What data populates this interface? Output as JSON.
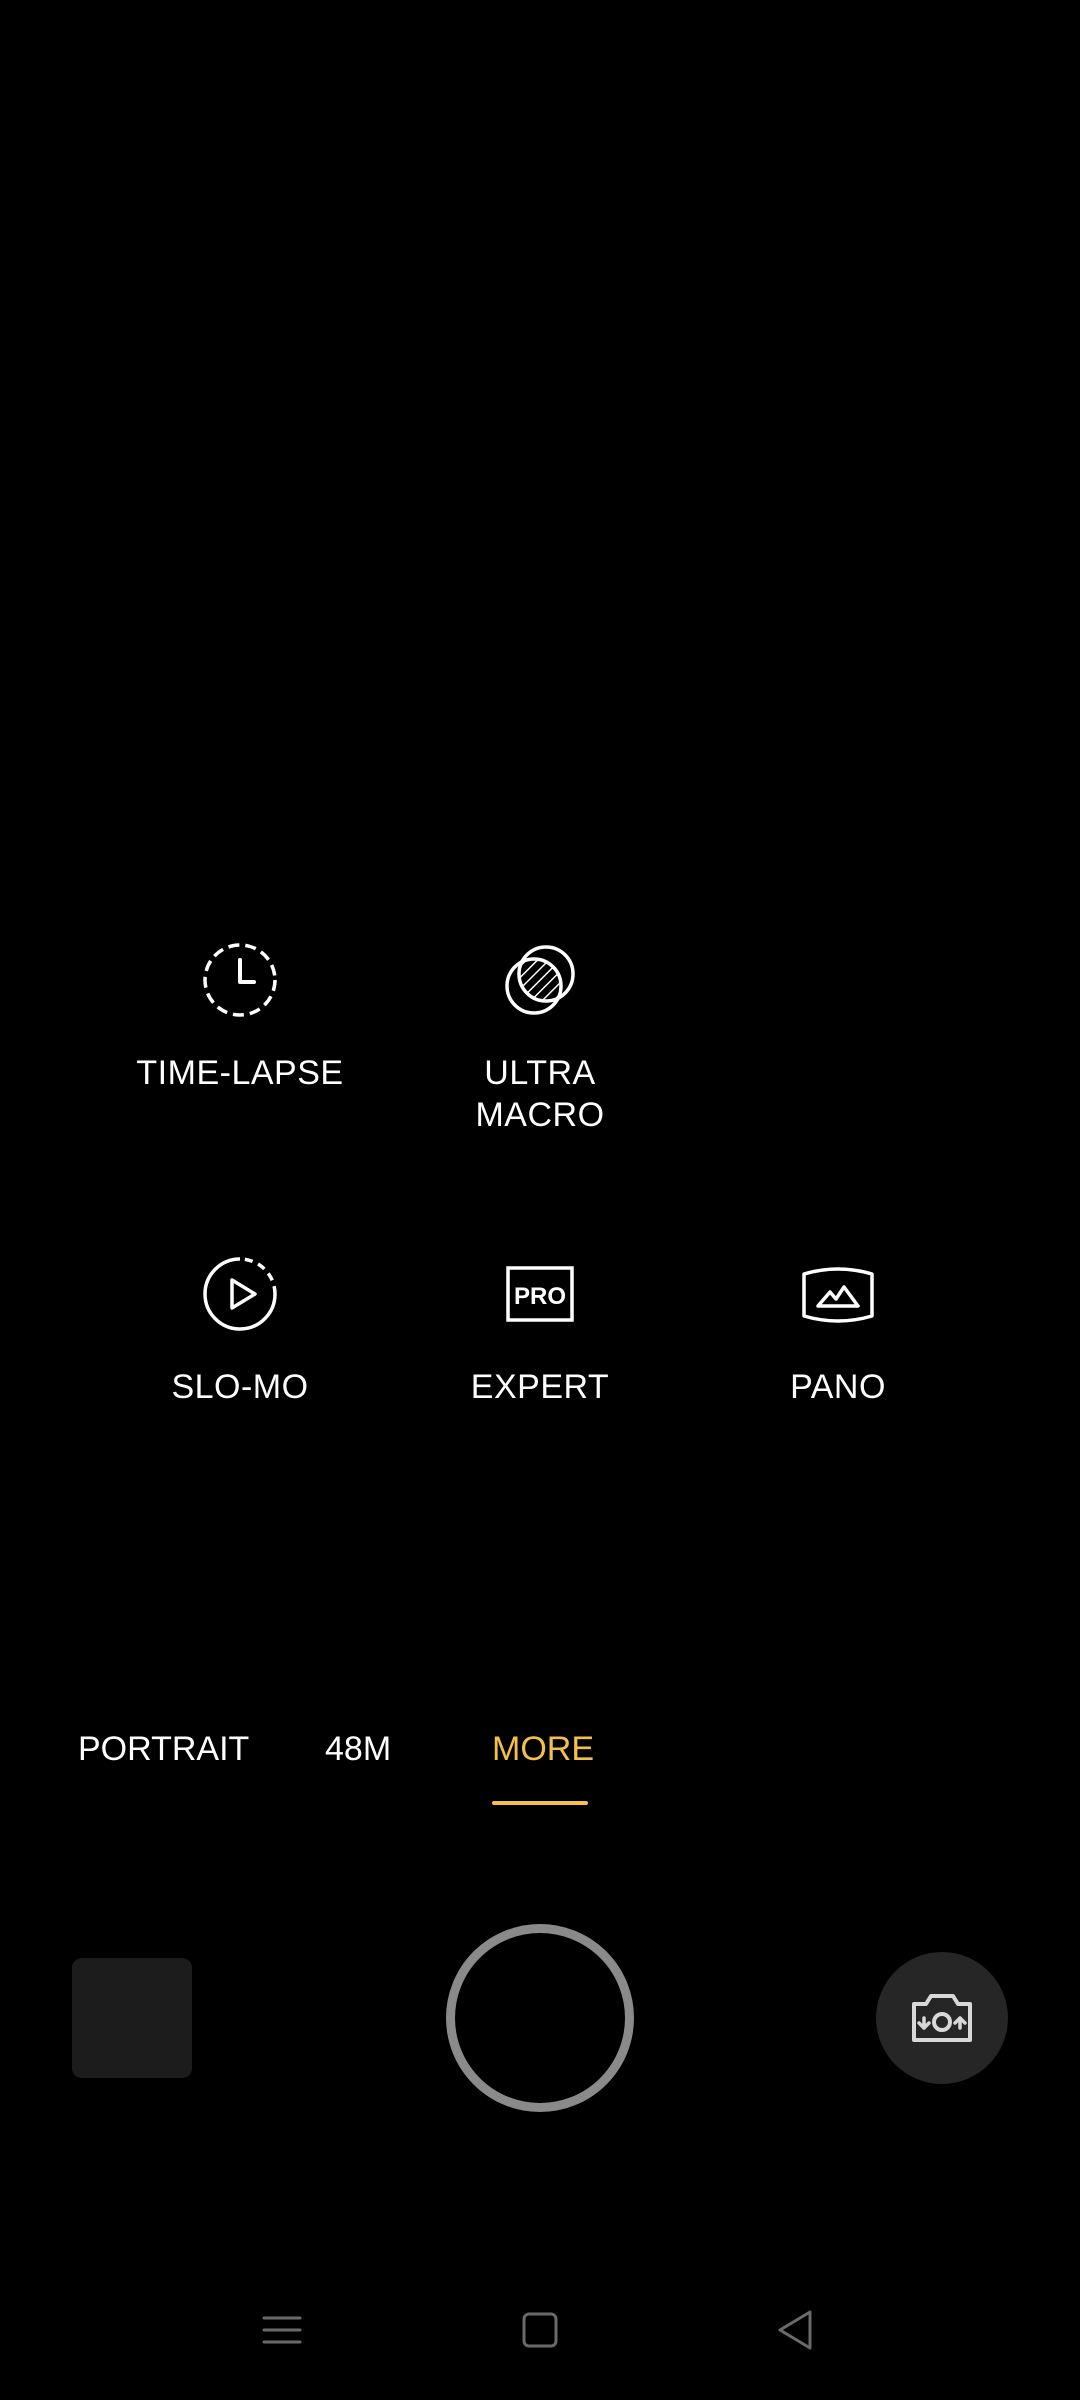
{
  "modes": [
    {
      "label_lines": [
        "TIME-LAPSE"
      ],
      "icon": "time-lapse-icon"
    },
    {
      "label_lines": [
        "ULTRA",
        "MACRO"
      ],
      "icon": "ultra-macro-icon"
    },
    {
      "label_lines": [
        "SLO-MO"
      ],
      "icon": "slo-mo-icon"
    },
    {
      "label_lines": [
        "EXPERT"
      ],
      "icon": "pro-icon",
      "icon_text": "PRO"
    },
    {
      "label_lines": [
        "PANO"
      ],
      "icon": "pano-icon"
    }
  ],
  "tabs": [
    {
      "label": "PORTRAIT",
      "active": false
    },
    {
      "label": "48M",
      "active": false
    },
    {
      "label": "MORE",
      "active": true
    }
  ],
  "controls": {
    "gallery": "gallery-thumbnail",
    "shutter": "shutter-button",
    "switch_camera": "switch-camera-icon"
  },
  "navigation": {
    "buttons": [
      "menu-icon",
      "home-icon",
      "back-icon"
    ]
  },
  "colors": {
    "background": "#000000",
    "accent": "#f5c04a",
    "text": "#ffffff",
    "shutter_ring": "#8a8a8a",
    "button_bg": "#262626"
  }
}
